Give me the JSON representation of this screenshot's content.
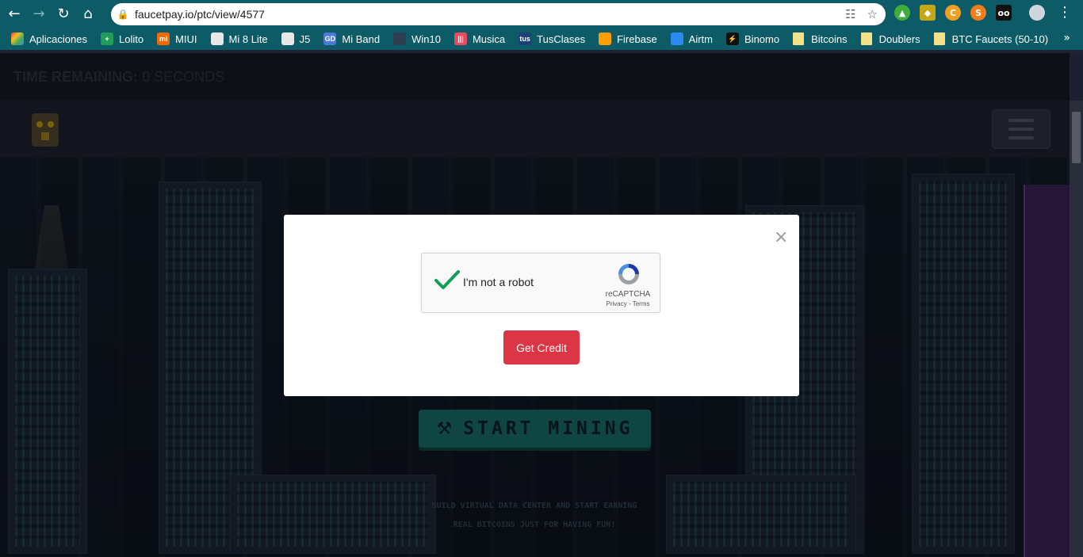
{
  "browser": {
    "url": "faucetpay.io/ptc/view/4577",
    "bookmarks": [
      {
        "label": "Aplicaciones",
        "icon": "apps-grid-icon",
        "color": "#e8453c"
      },
      {
        "label": "Lolito",
        "icon": "lolito-icon",
        "color": "#1e9e57"
      },
      {
        "label": "MIUI",
        "icon": "miui-icon",
        "color": "#f56a00"
      },
      {
        "label": "Mi 8 Lite",
        "icon": "page-icon",
        "color": "#e8e8e8"
      },
      {
        "label": "J5",
        "icon": "page-icon",
        "color": "#e8e8e8"
      },
      {
        "label": "Mi Band",
        "icon": "miband-icon",
        "color": "#4a79d8"
      },
      {
        "label": "Win10",
        "icon": "win10-icon",
        "color": "#2c3e50"
      },
      {
        "label": "Musica",
        "icon": "music-icon",
        "color": "#e84a5f"
      },
      {
        "label": "TusClases",
        "icon": "tusclases-icon",
        "color": "#1d3f7a"
      },
      {
        "label": "Firebase",
        "icon": "firebase-icon",
        "color": "#ffa000"
      },
      {
        "label": "Airtm",
        "icon": "airtm-icon",
        "color": "#2c8bf2"
      },
      {
        "label": "Binomo",
        "icon": "binomo-icon",
        "color": "#111111"
      },
      {
        "label": "Bitcoins",
        "icon": "folder-icon",
        "color": "#f3e08b"
      },
      {
        "label": "Doublers",
        "icon": "folder-icon",
        "color": "#f3e08b"
      },
      {
        "label": "BTC Faucets (50-10)",
        "icon": "folder-icon",
        "color": "#f3e08b"
      }
    ]
  },
  "timer": {
    "label": "TIME REMAINING:",
    "value": "0 SECONDS"
  },
  "site": {
    "cta_label": "START MINING",
    "tagline_line1": "BUILD VIRTUAL DATA CENTER AND START EARNING",
    "tagline_line2": "REAL BITCOINS JUST FOR HAVING FUN!"
  },
  "modal": {
    "close_symbol": "×",
    "captcha_label": "I'm not a robot",
    "captcha_brand": "reCAPTCHA",
    "captcha_links": "Privacy - Terms",
    "captcha_checked": true,
    "button_label": "Get Credit",
    "button_color": "#dc3545"
  }
}
